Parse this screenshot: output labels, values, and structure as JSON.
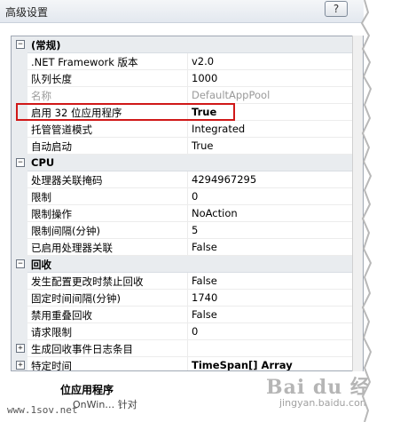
{
  "window": {
    "title": "高级设置",
    "help_label": "?"
  },
  "grid": {
    "rows": [
      {
        "kind": "category",
        "expander": "⊟",
        "name": "(常规)"
      },
      {
        "kind": "prop",
        "name": ".NET Framework 版本",
        "value": "v2.0"
      },
      {
        "kind": "prop",
        "name": "队列长度",
        "value": "1000"
      },
      {
        "kind": "prop",
        "name": "名称",
        "value": "DefaultAppPool",
        "disabled": true
      },
      {
        "kind": "prop",
        "name": "启用 32 位应用程序",
        "value": "True",
        "bold": true,
        "highlighted": true
      },
      {
        "kind": "prop",
        "name": "托管管道模式",
        "value": "Integrated"
      },
      {
        "kind": "prop",
        "name": "自动启动",
        "value": "True"
      },
      {
        "kind": "category",
        "expander": "⊟",
        "name": "CPU"
      },
      {
        "kind": "prop",
        "name": "处理器关联掩码",
        "value": "4294967295"
      },
      {
        "kind": "prop",
        "name": "限制",
        "value": "0"
      },
      {
        "kind": "prop",
        "name": "限制操作",
        "value": "NoAction"
      },
      {
        "kind": "prop",
        "name": "限制间隔(分钟)",
        "value": "5"
      },
      {
        "kind": "prop",
        "name": "已启用处理器关联",
        "value": "False"
      },
      {
        "kind": "category",
        "expander": "⊟",
        "name": "回收"
      },
      {
        "kind": "prop",
        "name": "发生配置更改时禁止回收",
        "value": "False"
      },
      {
        "kind": "prop",
        "name": "固定时间间隔(分钟)",
        "value": "1740"
      },
      {
        "kind": "prop",
        "name": "禁用重叠回收",
        "value": "False"
      },
      {
        "kind": "prop",
        "name": "请求限制",
        "value": "0"
      },
      {
        "kind": "prop",
        "expander": "⊞",
        "name": "生成回收事件日志条目",
        "value": ""
      },
      {
        "kind": "prop",
        "expander": "⊞",
        "name": "特定时间",
        "value": "TimeSpan[] Array",
        "bold": true
      }
    ]
  },
  "description": {
    "title": "位应用程序",
    "text": "OnWin…  针对"
  },
  "footer": {
    "site": "www.1sov.net",
    "watermark": "Bai du 经验",
    "watermark_sub": "jingyan.baidu.com"
  },
  "colors": {
    "highlight_border": "#d01818",
    "category_bg": "#e9ecef"
  }
}
